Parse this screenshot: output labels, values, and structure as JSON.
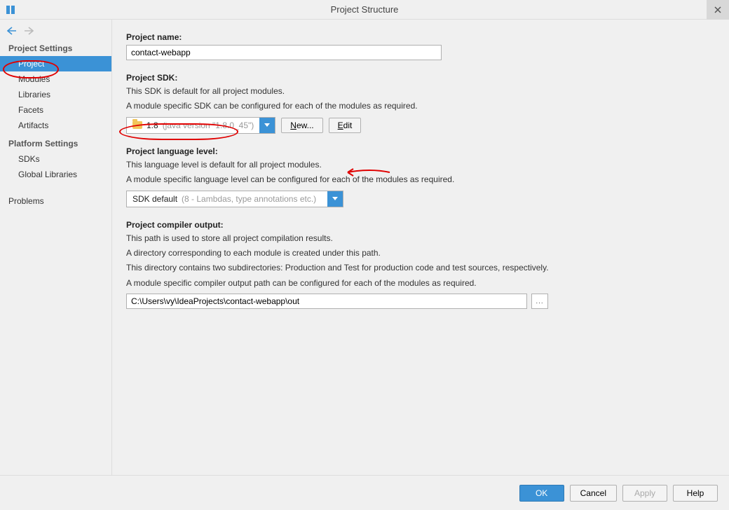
{
  "window": {
    "title": "Project Structure"
  },
  "sidebar": {
    "sections": [
      {
        "label": "Project Settings",
        "items": [
          "Project",
          "Modules",
          "Libraries",
          "Facets",
          "Artifacts"
        ]
      },
      {
        "label": "Platform Settings",
        "items": [
          "SDKs",
          "Global Libraries"
        ]
      }
    ],
    "extra": [
      "Problems"
    ],
    "active": "Project"
  },
  "content": {
    "projectName": {
      "label": "Project name:",
      "value": "contact-webapp"
    },
    "projectSdk": {
      "label": "Project SDK:",
      "descr1": "This SDK is default for all project modules.",
      "descr2": "A module specific SDK can be configured for each of the modules as required.",
      "combo": {
        "prefix": "1.8",
        "suffix": "(java version \"1.8.0_45\")"
      },
      "newBtn": "New...",
      "editBtn": "Edit"
    },
    "languageLevel": {
      "label": "Project language level:",
      "descr1": "This language level is default for all project modules.",
      "descr2": "A module specific language level can be configured for each of the modules as required.",
      "combo": {
        "prefix": "SDK default",
        "suffix": "(8 - Lambdas, type annotations etc.)"
      }
    },
    "compilerOutput": {
      "label": "Project compiler output:",
      "descr1": "This path is used to store all project compilation results.",
      "descr2": "A directory corresponding to each module is created under this path.",
      "descr3": "This directory contains two subdirectories: Production and Test for production code and test sources, respectively.",
      "descr4": "A module specific compiler output path can be configured for each of the modules as required.",
      "value": "C:\\Users\\vy\\IdeaProjects\\contact-webapp\\out"
    }
  },
  "footer": {
    "ok": "OK",
    "cancel": "Cancel",
    "apply": "Apply",
    "help": "Help"
  }
}
